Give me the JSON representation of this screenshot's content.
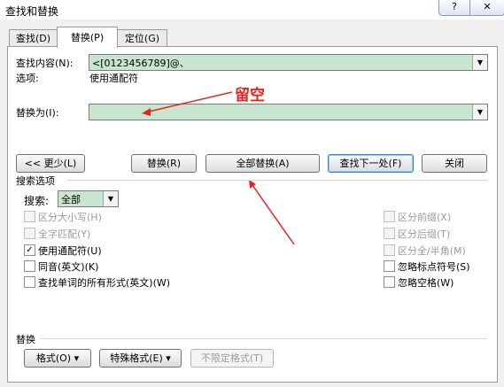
{
  "window": {
    "title": "查找和替换",
    "help_glyph": "?",
    "close_glyph": "✕"
  },
  "tabs": [
    {
      "label": "查找(D)"
    },
    {
      "label": "替换(P)"
    },
    {
      "label": "定位(G)"
    }
  ],
  "find": {
    "label": "查找内容(N):",
    "value": "<[0123456789]@、",
    "options_label": "选项:",
    "options_value": "使用通配符"
  },
  "replace": {
    "label": "替换为(I):",
    "value": ""
  },
  "annotation": {
    "text": "留空",
    "color": "#e8231f"
  },
  "buttons": {
    "less": "<< 更少(L)",
    "replace": "替换(R)",
    "replace_all": "全部替换(A)",
    "find_next": "查找下一处(F)",
    "close": "关闭"
  },
  "search_options": {
    "section_label": "搜索选项",
    "search_label": "搜索:",
    "search_value": "全部",
    "left": [
      {
        "label": "区分大小写(H)",
        "checked": false,
        "enabled": false
      },
      {
        "label": "全字匹配(Y)",
        "checked": false,
        "enabled": false
      },
      {
        "label": "使用通配符(U)",
        "checked": true,
        "enabled": true
      },
      {
        "label": "同音(英文)(K)",
        "checked": false,
        "enabled": true
      },
      {
        "label": "查找单词的所有形式(英文)(W)",
        "checked": false,
        "enabled": true
      }
    ],
    "right": [
      {
        "label": "区分前缀(X)",
        "checked": false,
        "enabled": false
      },
      {
        "label": "区分后缀(T)",
        "checked": false,
        "enabled": false
      },
      {
        "label": "区分全/半角(M)",
        "checked": false,
        "enabled": false
      },
      {
        "label": "忽略标点符号(S)",
        "checked": false,
        "enabled": true
      },
      {
        "label": "忽略空格(W)",
        "checked": false,
        "enabled": true
      }
    ]
  },
  "replace_section": {
    "label": "替换",
    "format_button": "格式(O) ▾",
    "special_button": "特殊格式(E) ▾",
    "no_format_button": "不限定格式(T)"
  },
  "colors": {
    "field_bg": "#c8e6cf",
    "annotation": "#e8231f"
  }
}
